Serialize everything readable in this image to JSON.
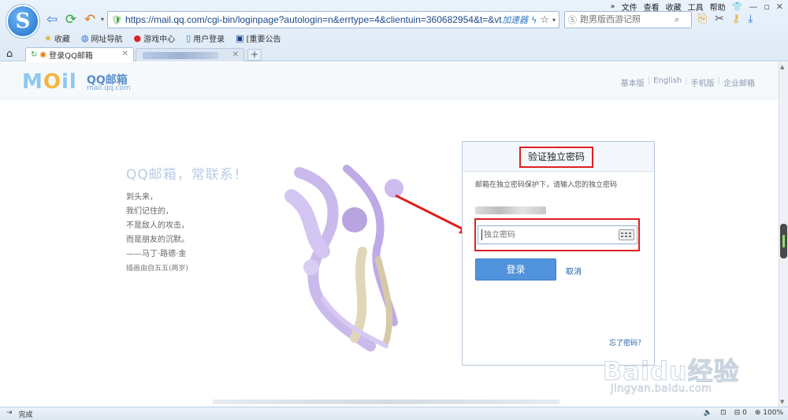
{
  "browser": {
    "logo_letter": "S",
    "menu": [
      "»",
      "文件",
      "查看",
      "收藏",
      "工具",
      "帮助"
    ],
    "url": "https://mail.qq.com/cgi-bin/loginpage?autologin=n&errtype=4&clientuin=360682954&t=&vt",
    "accelerator": "加速器",
    "search_placeholder": "跑男版西游记照",
    "bookmarks": [
      "收藏",
      "网址导航",
      "游戏中心",
      "用户登录",
      "[重要公告"
    ],
    "tabs": [
      {
        "label": "登录QQ邮箱"
      }
    ],
    "new_tab": "+"
  },
  "header": {
    "logo_mail": "MOil",
    "logo_qq": "QQ邮箱",
    "logo_domain": "mail.qq.com",
    "links": [
      "基本版",
      "English",
      "手机版",
      "企业邮箱"
    ]
  },
  "left": {
    "slogan": "QQ邮箱，常联系！",
    "poem": [
      "到头来，",
      "我们记住的，",
      "不是敌人的攻击，",
      "而是朋友的沉默。",
      "——马丁·路德·金"
    ],
    "credit": "插画由自五五(两岁)"
  },
  "login": {
    "title": "验证独立密码",
    "hint": "邮箱在独立密码保护下，请输入您的独立密码",
    "password_placeholder": "独立密码",
    "login_button": "登录",
    "cancel": "取消",
    "forgot": "忘了密码？"
  },
  "status": {
    "left": "完成",
    "zoom": "100%",
    "count": "0"
  },
  "watermark": {
    "text": "Baidu经验",
    "sub": "jingyan.baidu.com"
  },
  "colors": {
    "highlight_red": "#e02020",
    "login_blue": "#5193dc",
    "link_blue": "#1e5fa8"
  }
}
